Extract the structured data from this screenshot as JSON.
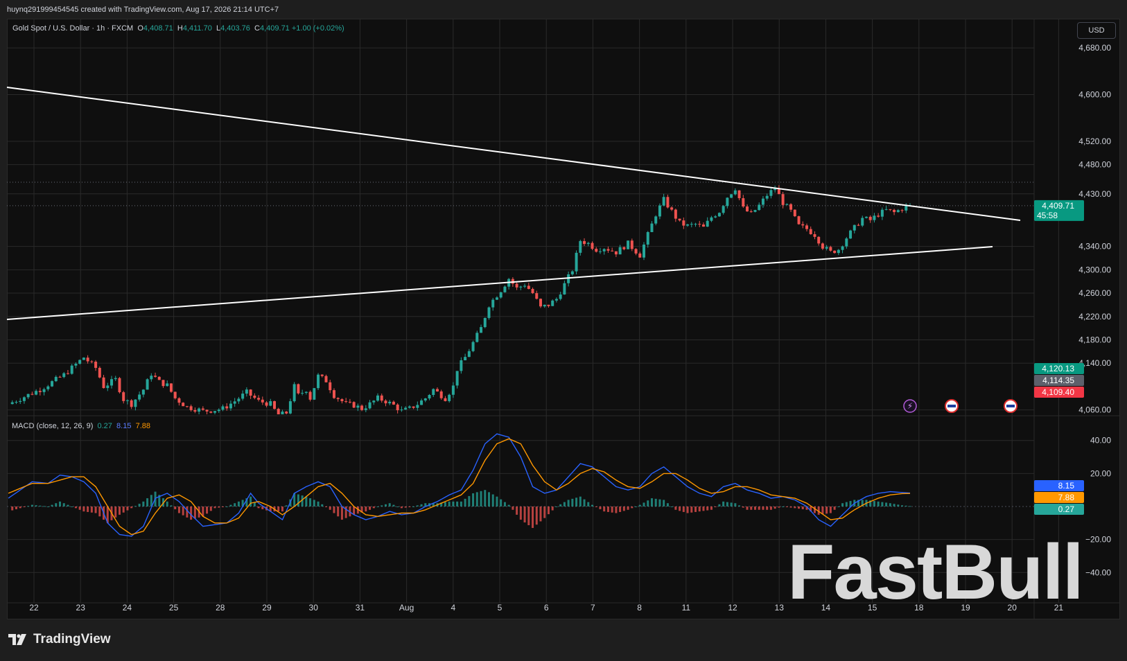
{
  "header": {
    "credit": "huynq291999454545 created with TradingView.com, Aug 17, 2026 21:14 UTC+7"
  },
  "legend": {
    "symbol": "Gold Spot / U.S. Dollar · 1h · FXCM",
    "o_key": "O",
    "o_val": "4,408.71",
    "h_key": "H",
    "h_val": "4,411.70",
    "l_key": "L",
    "l_val": "4,403.76",
    "c_key": "C",
    "c_val": "4,409.71",
    "change": "+1.00 (+0.02%)"
  },
  "currency_button": "USD",
  "macd_legend": {
    "label": "MACD (close, 12, 26, 9)",
    "hist": "0.27",
    "macd": "8.15",
    "signal": "7.88"
  },
  "footer": {
    "brand": "TradingView"
  },
  "watermark": "FastBull",
  "colors": {
    "up": "#26a69a",
    "down": "#ef5350",
    "macd_line": "#2962ff",
    "signal_line": "#ff9800",
    "hist_up": "#26a69a",
    "hist_down": "#ef5350",
    "background": "#0f0f0f",
    "grid": "#2a2a2a",
    "trendline": "#ffffff"
  },
  "chart_data": [
    {
      "type": "candlestick",
      "title": "Gold Spot / U.S. Dollar · 1h · FXCM",
      "x_tick_labels": [
        "22",
        "23",
        "24",
        "25",
        "28",
        "29",
        "30",
        "31",
        "Aug",
        "4",
        "5",
        "6",
        "7",
        "8",
        "11",
        "12",
        "13",
        "14",
        "15",
        "18",
        "19",
        "20",
        "21"
      ],
      "y_ticks": [
        4060,
        4140,
        4180,
        4220,
        4260,
        4300,
        4340,
        4430,
        4480,
        4520,
        4600,
        4680
      ],
      "y_tick_labels": [
        "4,060.00",
        "4,140.00",
        "4,180.00",
        "4,220.00",
        "4,260.00",
        "4,300.00",
        "4,340.00",
        "4,430.00",
        "4,480.00",
        "4,520.00",
        "4,600.00",
        "4,680.00"
      ],
      "ylim": [
        4050,
        4730
      ],
      "price_labels": [
        {
          "value": 4409.71,
          "text": "4,409.71",
          "sub": "45:58",
          "color": "#089981"
        },
        {
          "value": 4120.13,
          "text": "4,120.13",
          "color": "#089981"
        },
        {
          "value": 4114.35,
          "text": "4,114.35",
          "color": "#5d606b"
        },
        {
          "value": 4109.4,
          "text": "4,109.40",
          "color": "#f23645"
        }
      ],
      "dotted_levels": [
        4450,
        4409.71
      ],
      "close_path": [
        [
          0,
          4070
        ],
        [
          8,
          4095
        ],
        [
          14,
          4120
        ],
        [
          19,
          4150
        ],
        [
          22,
          4132
        ],
        [
          24,
          4100
        ],
        [
          27,
          4112
        ],
        [
          29,
          4078
        ],
        [
          31,
          4070
        ],
        [
          34,
          4095
        ],
        [
          36,
          4122
        ],
        [
          38,
          4108
        ],
        [
          40,
          4102
        ],
        [
          42,
          4080
        ],
        [
          44,
          4070
        ],
        [
          45,
          4065
        ],
        [
          47,
          4062
        ],
        [
          49,
          4058
        ],
        [
          52,
          4060
        ],
        [
          54,
          4062
        ],
        [
          57,
          4075
        ],
        [
          60,
          4090
        ],
        [
          63,
          4075
        ],
        [
          66,
          4070
        ],
        [
          68,
          4050
        ],
        [
          70,
          4055
        ],
        [
          72,
          4100
        ],
        [
          73,
          4085
        ],
        [
          75,
          4095
        ],
        [
          76,
          4080
        ],
        [
          78,
          4118
        ],
        [
          80,
          4110
        ],
        [
          82,
          4085
        ],
        [
          85,
          4070
        ],
        [
          87,
          4068
        ],
        [
          89,
          4062
        ],
        [
          91,
          4070
        ],
        [
          93,
          4080
        ],
        [
          95,
          4075
        ],
        [
          97,
          4068
        ],
        [
          99,
          4058
        ],
        [
          101,
          4062
        ],
        [
          103,
          4070
        ],
        [
          105,
          4080
        ],
        [
          107,
          4095
        ],
        [
          109,
          4085
        ],
        [
          110,
          4080
        ],
        [
          112,
          4100
        ],
        [
          113,
          4130
        ],
        [
          115,
          4150
        ],
        [
          117,
          4175
        ],
        [
          119,
          4200
        ],
        [
          121,
          4240
        ],
        [
          124,
          4265
        ],
        [
          126,
          4285
        ],
        [
          128,
          4268
        ],
        [
          130,
          4275
        ],
        [
          132,
          4260
        ],
        [
          134,
          4235
        ],
        [
          136,
          4240
        ],
        [
          138,
          4250
        ],
        [
          140,
          4275
        ],
        [
          142,
          4300
        ],
        [
          144,
          4350
        ],
        [
          146,
          4345
        ],
        [
          148,
          4335
        ],
        [
          150,
          4338
        ],
        [
          153,
          4330
        ],
        [
          156,
          4345
        ],
        [
          159,
          4325
        ],
        [
          161,
          4360
        ],
        [
          163,
          4395
        ],
        [
          165,
          4420
        ],
        [
          167,
          4400
        ],
        [
          169,
          4380
        ],
        [
          171,
          4375
        ],
        [
          173,
          4378
        ],
        [
          175,
          4372
        ],
        [
          177,
          4390
        ],
        [
          179,
          4400
        ],
        [
          181,
          4425
        ],
        [
          183,
          4440
        ],
        [
          185,
          4405
        ],
        [
          187,
          4395
        ],
        [
          189,
          4410
        ],
        [
          191,
          4428
        ],
        [
          193,
          4440
        ],
        [
          195,
          4415
        ],
        [
          197,
          4400
        ],
        [
          199,
          4375
        ],
        [
          201,
          4370
        ],
        [
          203,
          4360
        ],
        [
          205,
          4340
        ],
        [
          207,
          4330
        ],
        [
          209,
          4335
        ],
        [
          211,
          4355
        ],
        [
          213,
          4372
        ],
        [
          215,
          4388
        ],
        [
          217,
          4385
        ],
        [
          219,
          4395
        ],
        [
          221,
          4402
        ],
        [
          223,
          4398
        ],
        [
          225,
          4405
        ],
        [
          227,
          4409.71
        ]
      ]
    },
    {
      "type": "macd",
      "title": "MACD (close, 12, 26, 9)",
      "y_ticks": [
        40,
        20,
        -20,
        -40
      ],
      "y_tick_labels": [
        "40.00",
        "20.00",
        "−20.00",
        "−40.00"
      ],
      "ylim": [
        -55,
        55
      ],
      "value_labels": [
        {
          "value": 8.15,
          "text": "8.15",
          "color": "#2962ff"
        },
        {
          "value": 7.88,
          "text": "7.88",
          "color": "#ff9800"
        },
        {
          "value": 0.27,
          "text": "0.27",
          "color": "#26a69a"
        }
      ],
      "macd_path": [
        [
          0,
          5
        ],
        [
          6,
          15
        ],
        [
          10,
          14
        ],
        [
          13,
          19
        ],
        [
          16,
          18
        ],
        [
          19,
          15
        ],
        [
          22,
          8
        ],
        [
          25,
          -10
        ],
        [
          28,
          -17
        ],
        [
          31,
          -18
        ],
        [
          34,
          -12
        ],
        [
          37,
          5
        ],
        [
          40,
          8
        ],
        [
          43,
          3
        ],
        [
          46,
          -5
        ],
        [
          49,
          -12
        ],
        [
          52,
          -11
        ],
        [
          55,
          -10
        ],
        [
          58,
          -4
        ],
        [
          61,
          8
        ],
        [
          63,
          2
        ],
        [
          66,
          -3
        ],
        [
          69,
          -8
        ],
        [
          72,
          8
        ],
        [
          75,
          12
        ],
        [
          78,
          15
        ],
        [
          81,
          12
        ],
        [
          84,
          0
        ],
        [
          87,
          -5
        ],
        [
          90,
          -8
        ],
        [
          93,
          -6
        ],
        [
          96,
          -3
        ],
        [
          99,
          -5
        ],
        [
          102,
          -4
        ],
        [
          105,
          0
        ],
        [
          108,
          3
        ],
        [
          111,
          7
        ],
        [
          114,
          10
        ],
        [
          117,
          22
        ],
        [
          120,
          38
        ],
        [
          123,
          44
        ],
        [
          126,
          42
        ],
        [
          129,
          30
        ],
        [
          132,
          12
        ],
        [
          135,
          8
        ],
        [
          138,
          10
        ],
        [
          141,
          18
        ],
        [
          144,
          26
        ],
        [
          147,
          24
        ],
        [
          150,
          18
        ],
        [
          153,
          12
        ],
        [
          156,
          10
        ],
        [
          159,
          12
        ],
        [
          162,
          20
        ],
        [
          165,
          24
        ],
        [
          168,
          18
        ],
        [
          171,
          12
        ],
        [
          174,
          8
        ],
        [
          177,
          6
        ],
        [
          180,
          12
        ],
        [
          183,
          14
        ],
        [
          186,
          10
        ],
        [
          189,
          8
        ],
        [
          192,
          5
        ],
        [
          195,
          6
        ],
        [
          198,
          4
        ],
        [
          201,
          0
        ],
        [
          204,
          -8
        ],
        [
          207,
          -12
        ],
        [
          210,
          -5
        ],
        [
          213,
          2
        ],
        [
          216,
          6
        ],
        [
          219,
          8
        ],
        [
          222,
          9
        ],
        [
          225,
          8.5
        ],
        [
          227,
          8.15
        ]
      ],
      "signal_path": [
        [
          0,
          8
        ],
        [
          6,
          14
        ],
        [
          10,
          14
        ],
        [
          13,
          16
        ],
        [
          16,
          18
        ],
        [
          19,
          18
        ],
        [
          22,
          12
        ],
        [
          25,
          0
        ],
        [
          28,
          -12
        ],
        [
          31,
          -17
        ],
        [
          34,
          -15
        ],
        [
          37,
          -4
        ],
        [
          40,
          5
        ],
        [
          43,
          7
        ],
        [
          46,
          3
        ],
        [
          49,
          -6
        ],
        [
          52,
          -10
        ],
        [
          55,
          -10
        ],
        [
          58,
          -7
        ],
        [
          61,
          2
        ],
        [
          63,
          3
        ],
        [
          66,
          0
        ],
        [
          69,
          -5
        ],
        [
          72,
          0
        ],
        [
          75,
          6
        ],
        [
          78,
          12
        ],
        [
          81,
          14
        ],
        [
          84,
          8
        ],
        [
          87,
          0
        ],
        [
          90,
          -5
        ],
        [
          93,
          -6
        ],
        [
          96,
          -5
        ],
        [
          99,
          -4
        ],
        [
          102,
          -4
        ],
        [
          105,
          -2
        ],
        [
          108,
          1
        ],
        [
          111,
          4
        ],
        [
          114,
          7
        ],
        [
          117,
          14
        ],
        [
          120,
          28
        ],
        [
          123,
          38
        ],
        [
          126,
          41
        ],
        [
          129,
          38
        ],
        [
          132,
          25
        ],
        [
          135,
          15
        ],
        [
          138,
          10
        ],
        [
          141,
          14
        ],
        [
          144,
          20
        ],
        [
          147,
          23
        ],
        [
          150,
          21
        ],
        [
          153,
          16
        ],
        [
          156,
          12
        ],
        [
          159,
          11
        ],
        [
          162,
          15
        ],
        [
          165,
          20
        ],
        [
          168,
          20
        ],
        [
          171,
          16
        ],
        [
          174,
          11
        ],
        [
          177,
          8
        ],
        [
          180,
          9
        ],
        [
          183,
          12
        ],
        [
          186,
          12
        ],
        [
          189,
          10
        ],
        [
          192,
          7
        ],
        [
          195,
          6
        ],
        [
          198,
          5
        ],
        [
          201,
          2
        ],
        [
          204,
          -3
        ],
        [
          207,
          -8
        ],
        [
          210,
          -7
        ],
        [
          213,
          -2
        ],
        [
          216,
          2
        ],
        [
          219,
          5
        ],
        [
          222,
          7
        ],
        [
          225,
          7.8
        ],
        [
          227,
          7.88
        ]
      ]
    }
  ]
}
